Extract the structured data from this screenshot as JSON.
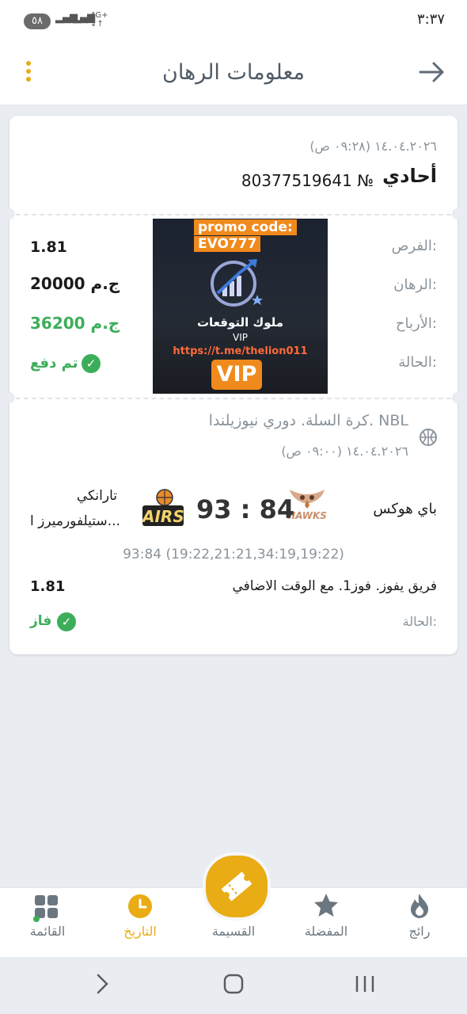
{
  "status_bar": {
    "battery": "٥٨",
    "network": "4G+",
    "time": "٣:٣٧"
  },
  "header": {
    "title": "معلومات الرهان",
    "back_icon": "arrow-right-icon",
    "menu_icon": "kebab-menu-icon"
  },
  "bet": {
    "datetime": "١٤.٠٤.٢٠٢٦ (٠٩:٢٨ ص)",
    "type": "أحادي",
    "number_label": "№",
    "number": "80377519641",
    "odds_label": "الفرص:",
    "odds_value": "1.81",
    "stake_label": "الرهان:",
    "stake_value": "20000 ج.م",
    "winnings_label": "الأرباح:",
    "winnings_value": "36200 ج.م",
    "status_label": "الحالة:",
    "status_value": "تم دفع"
  },
  "promo": {
    "code_line1": "promo code:",
    "code_line2": "EVO777",
    "brand": "ملوك التوقعات",
    "vip_small": "VIP",
    "link": "https://t.me/thelion011",
    "vip_badge": "VIP"
  },
  "event": {
    "sport_icon": "basketball-icon",
    "league": "كرة السلة. دوري نيوزيلندا. NBL",
    "datetime": "١٤.٠٤.٢٠٢٦ (٠٩:٠٠ ص)",
    "home_team": "باي هوكس",
    "home_logo_text": "HAWKS",
    "away_team_line1": "تارانكي",
    "away_team_line2": "ستيلفورميرز ا...",
    "away_logo_text": "AIRS",
    "score_home": "84",
    "score_away": "93",
    "score_separator": ":",
    "periods": "93:84 (19:22,21:21,34:19,19:22)",
    "market": "فريق يفوز. فوز1. مع الوقت الاضافي",
    "market_odds": "1.81",
    "status_label": "الحالة:",
    "status_value": "فاز"
  },
  "bottom_nav": {
    "items": [
      {
        "label": "رائج",
        "icon": "flame-icon"
      },
      {
        "label": "المفضلة",
        "icon": "star-icon"
      },
      {
        "label": "القسيمة",
        "icon": "ticket-icon"
      },
      {
        "label": "التاريخ",
        "icon": "clock-icon"
      },
      {
        "label": "القائمة",
        "icon": "grid-menu-icon"
      }
    ]
  },
  "colors": {
    "accent": "#e9ac14",
    "success": "#3cae5a",
    "muted": "#8a939b",
    "background": "#e9edf2"
  }
}
